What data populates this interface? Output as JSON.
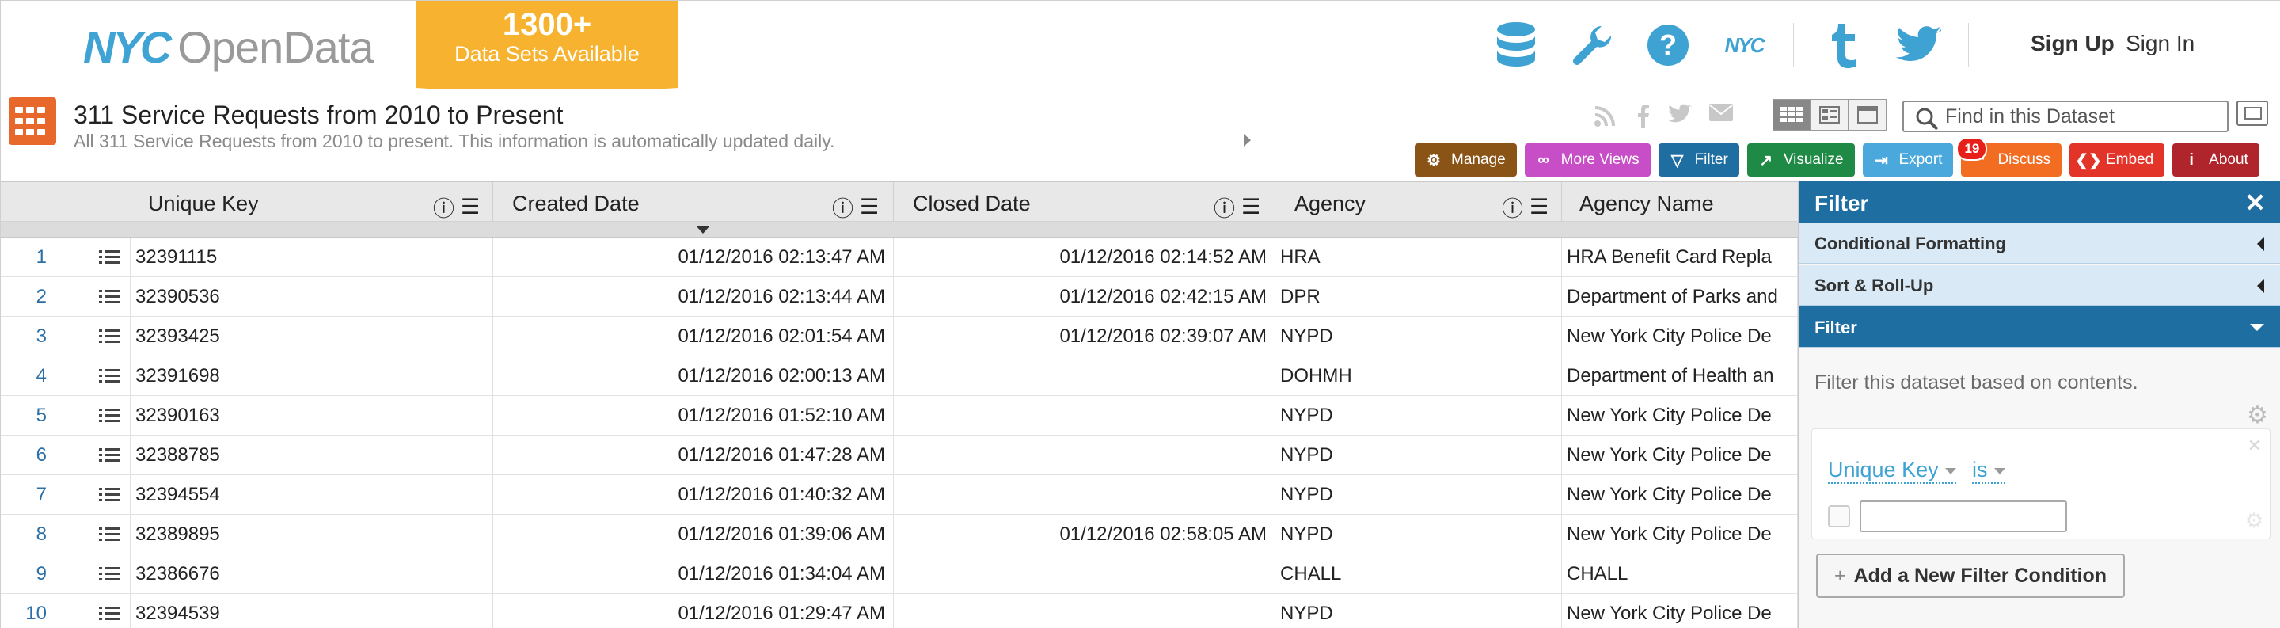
{
  "banner": {
    "logo_nyc": "NYC",
    "logo_opendata": "OpenData",
    "ribbon_big": "1300+",
    "ribbon_small": "Data Sets Available",
    "nav_nyc_label": "NYC",
    "sign_up": "Sign Up",
    "sign_in": "Sign In",
    "accent_color": "#3fa3d4",
    "ribbon_color": "#f7b22f",
    "icons": [
      "database-icon",
      "wrench-icon",
      "help-icon",
      "nyc-icon",
      "tumblr-icon",
      "twitter-icon"
    ]
  },
  "dataset": {
    "title": "311 Service Requests from 2010 to Present",
    "subtitle": "All 311 Service Requests from 2010 to present. This information is automatically updated daily.",
    "search_placeholder": "Find in this Dataset",
    "share_icons": [
      "rss-icon",
      "facebook-icon",
      "twitter-icon",
      "email-icon"
    ],
    "view_modes": [
      "grid-view-icon",
      "page-view-icon",
      "full-view-icon"
    ]
  },
  "actions": [
    {
      "label": "Manage",
      "color": "#8a5416",
      "icon": "gear-icon"
    },
    {
      "label": "More Views",
      "color": "#c74ec6",
      "icon": "glasses-icon"
    },
    {
      "label": "Filter",
      "color": "#1f6ea2",
      "icon": "funnel-icon"
    },
    {
      "label": "Visualize",
      "color": "#1f8a45",
      "icon": "chart-icon"
    },
    {
      "label": "Export",
      "color": "#4aa8dc",
      "icon": "export-icon"
    },
    {
      "label": "Discuss",
      "color": "#f26c22",
      "icon": "comment-icon",
      "badge": "19"
    },
    {
      "label": "Embed",
      "color": "#e3342a",
      "icon": "code-icon"
    },
    {
      "label": "About",
      "color": "#b0242c",
      "icon": "info-icon"
    }
  ],
  "table": {
    "columns": [
      "Unique Key",
      "Created Date",
      "Closed Date",
      "Agency",
      "Agency Name"
    ],
    "rows": [
      {
        "n": "1",
        "key": "32391115",
        "created": "01/12/2016 02:13:47 AM",
        "closed": "01/12/2016 02:14:52 AM",
        "agency": "HRA",
        "name": "HRA Benefit Card Repla"
      },
      {
        "n": "2",
        "key": "32390536",
        "created": "01/12/2016 02:13:44 AM",
        "closed": "01/12/2016 02:42:15 AM",
        "agency": "DPR",
        "name": "Department of Parks and"
      },
      {
        "n": "3",
        "key": "32393425",
        "created": "01/12/2016 02:01:54 AM",
        "closed": "01/12/2016 02:39:07 AM",
        "agency": "NYPD",
        "name": "New York City Police De"
      },
      {
        "n": "4",
        "key": "32391698",
        "created": "01/12/2016 02:00:13 AM",
        "closed": "",
        "agency": "DOHMH",
        "name": "Department of Health an"
      },
      {
        "n": "5",
        "key": "32390163",
        "created": "01/12/2016 01:52:10 AM",
        "closed": "",
        "agency": "NYPD",
        "name": "New York City Police De"
      },
      {
        "n": "6",
        "key": "32388785",
        "created": "01/12/2016 01:47:28 AM",
        "closed": "",
        "agency": "NYPD",
        "name": "New York City Police De"
      },
      {
        "n": "7",
        "key": "32394554",
        "created": "01/12/2016 01:40:32 AM",
        "closed": "",
        "agency": "NYPD",
        "name": "New York City Police De"
      },
      {
        "n": "8",
        "key": "32389895",
        "created": "01/12/2016 01:39:06 AM",
        "closed": "01/12/2016 02:58:05 AM",
        "agency": "NYPD",
        "name": "New York City Police De"
      },
      {
        "n": "9",
        "key": "32386676",
        "created": "01/12/2016 01:34:04 AM",
        "closed": "",
        "agency": "CHALL",
        "name": "CHALL"
      },
      {
        "n": "10",
        "key": "32394539",
        "created": "01/12/2016 01:29:47 AM",
        "closed": "",
        "agency": "NYPD",
        "name": "New York City Police De"
      }
    ]
  },
  "panel": {
    "title": "Filter",
    "sections": [
      "Conditional Formatting",
      "Sort & Roll-Up",
      "Filter"
    ],
    "description": "Filter this dataset based on contents.",
    "filter_column": "Unique Key",
    "filter_operator": "is",
    "filter_value": "",
    "add_button": "Add a New Filter Condition",
    "header_color": "#1f6ea2"
  }
}
